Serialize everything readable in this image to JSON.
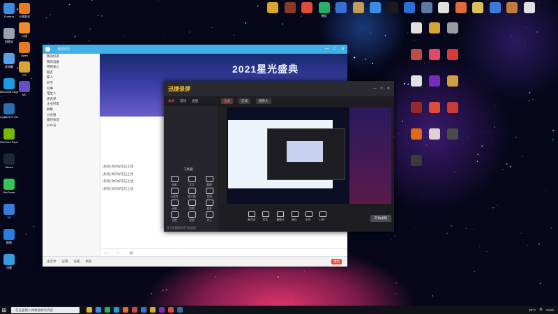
{
  "desktop": {
    "left_icons": [
      {
        "label": "Fortuna",
        "color": "#3a8de0"
      },
      {
        "label": "回收站",
        "color": "#9aa3ad"
      },
      {
        "label": "此电脑",
        "color": "#5aa0e6"
      },
      {
        "label": "Microsoft Edge",
        "color": "#1a9de0"
      },
      {
        "label": "Logitech G HUB",
        "color": "#2a6fb0"
      },
      {
        "label": "GeForce Experience",
        "color": "#76b900"
      },
      {
        "label": "Steam",
        "color": "#1b2838"
      },
      {
        "label": "WeGame",
        "color": "#35c35a"
      },
      {
        "label": "V2",
        "color": "#3a7bd5"
      },
      {
        "label": "酷狗",
        "color": "#2a7de0"
      },
      {
        "label": "迅雷",
        "color": "#3a9ae0"
      }
    ],
    "second_column_icons": [
      {
        "label": "火绒安全",
        "color": "#e87a1f"
      },
      {
        "label": "火绒",
        "color": "#f08a2a"
      },
      {
        "label": "Open",
        "color": "#e87a1f"
      },
      {
        "label": "CS",
        "color": "#d9a531"
      },
      {
        "label": "MC",
        "color": "#6a4ec8"
      }
    ],
    "top_icons": [
      {
        "label": "",
        "color": "#d9a531"
      },
      {
        "label": "",
        "color": "#8a3a2a"
      },
      {
        "label": "",
        "color": "#e04a3a"
      },
      {
        "label": "微信",
        "color": "#2aae67"
      },
      {
        "label": "",
        "color": "#3a6ed5"
      },
      {
        "label": "",
        "color": "#c49a5a"
      },
      {
        "label": "",
        "color": "#3a8de0"
      },
      {
        "label": "",
        "color": "#1b1b1b"
      },
      {
        "label": "",
        "color": "#2a6fd5"
      },
      {
        "label": "",
        "color": "#5a7aa0"
      },
      {
        "label": "",
        "color": "#e0e0e0"
      },
      {
        "label": "",
        "color": "#e06a3a"
      },
      {
        "label": "",
        "color": "#d9c05a"
      },
      {
        "label": "",
        "color": "#3a7bd5"
      },
      {
        "label": "",
        "color": "#c07a3a"
      },
      {
        "label": "",
        "color": "#e0e0e0"
      }
    ],
    "right_icons": [
      {
        "label": "",
        "color": "#e0e0e0"
      },
      {
        "label": "",
        "color": "#d9a531"
      },
      {
        "label": "",
        "color": "#9a9aa0"
      },
      {
        "label": "",
        "color": "#c04a4a"
      },
      {
        "label": "",
        "color": "#e04a6a"
      },
      {
        "label": "",
        "color": "#d83a3a"
      },
      {
        "label": "",
        "color": "#e0e0e0"
      },
      {
        "label": "",
        "color": "#7a2ac0"
      },
      {
        "label": "",
        "color": "#d0a040"
      },
      {
        "label": "",
        "color": "#9a2a2a"
      },
      {
        "label": "",
        "color": "#e04a3a"
      },
      {
        "label": "",
        "color": "#c83a3a"
      },
      {
        "label": "",
        "color": "#e06a1a"
      },
      {
        "label": "",
        "color": "#e0d0d0"
      },
      {
        "label": "",
        "color": "#4a4a4a"
      },
      {
        "label": "",
        "color": "#3a3a3a"
      }
    ]
  },
  "qq_window": {
    "title": "我的QQ",
    "controls": [
      "—",
      "□",
      "✕"
    ],
    "banner_text": "2021星光盛典",
    "contacts": [
      "我的好友",
      "我的设备",
      "特别关心",
      "朋友",
      "家人",
      "同学",
      "同事",
      "陌生人",
      "黑名单",
      "企业好友",
      "群聊",
      "讨论组",
      "临时会话",
      "公众号"
    ],
    "messages": [
      "[系统] 你的好友已上线",
      "[系统] 你的好友已上线",
      "[系统] 你的好友已上线",
      "[系统] 你的好友已上线"
    ],
    "input_tools": [
      "☺",
      "✂",
      "🖼"
    ],
    "bottom_items": [
      "主菜单",
      "应用",
      "设置",
      "更多"
    ],
    "badge": "更新"
  },
  "recorder_window": {
    "logo": "迅捷录屏",
    "header_controls": [
      "—",
      "□",
      "✕"
    ],
    "tabs": [
      {
        "label": "录屏",
        "active": true
      },
      {
        "label": "游戏"
      },
      {
        "label": "直播"
      }
    ],
    "sources": [
      {
        "label": "全屏",
        "active": true
      },
      {
        "label": "区域"
      },
      {
        "label": "摄像头"
      }
    ],
    "panel_title": "工具箱",
    "tools": [
      "画笔",
      "文字",
      "截图",
      "马赛克",
      "放大镜",
      "音频",
      "录制",
      "剪辑",
      "更多",
      "设置",
      "帮助",
      "关于"
    ],
    "controls": [
      "麦克风",
      "声音",
      "摄像头",
      "鼠标",
      "水印",
      "计时"
    ],
    "start_label": "开始录制",
    "footer": "按下快捷键即可开始录屏"
  },
  "taskbar": {
    "search_placeholder": "在这里输入你要搜索的内容",
    "app_colors": [
      "#e0b030",
      "#3a8de0",
      "#2aae67",
      "#1a9de0",
      "#e06a3a",
      "#c04a4a",
      "#3a6ed5",
      "#d9a531",
      "#7a2ac0",
      "#e04a3a",
      "#2a6fb0"
    ],
    "weather": "26°C",
    "time": "19:56",
    "lang": "英"
  }
}
